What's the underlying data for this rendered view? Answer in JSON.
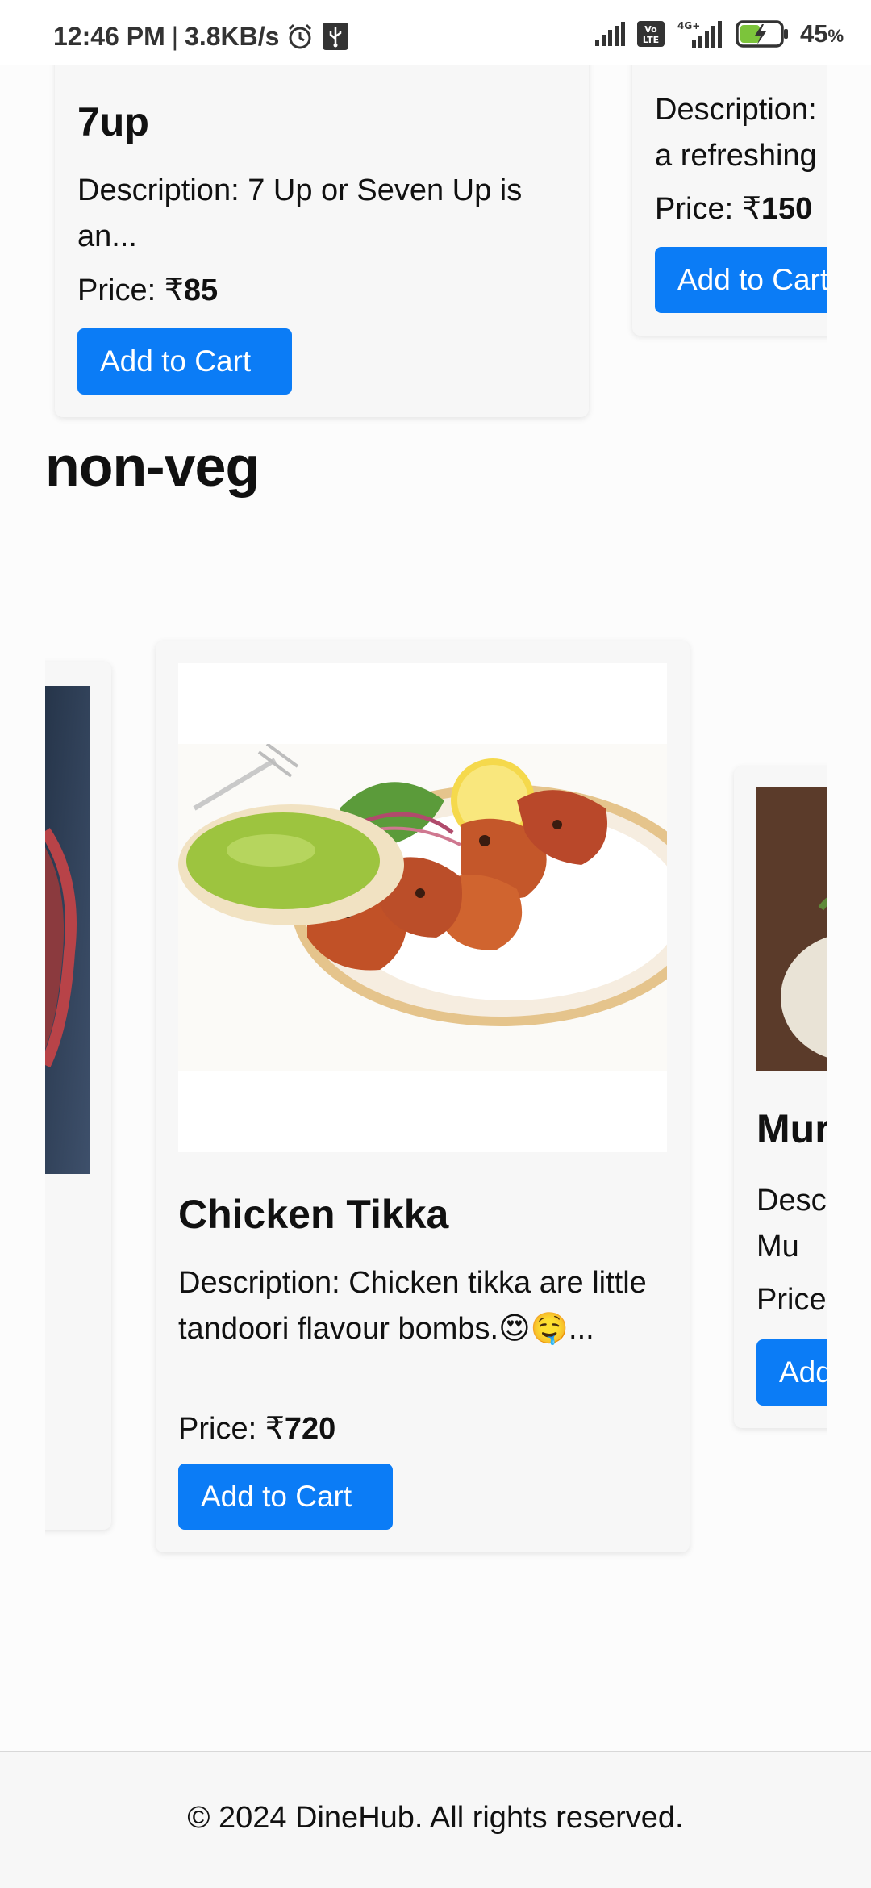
{
  "status_bar": {
    "time": "12:46 PM",
    "separator": "|",
    "net_speed": "3.8KB/s",
    "network_label": "4G+",
    "volte_label": "Vo LTE",
    "battery": "45",
    "battery_unit": "%"
  },
  "drinks": {
    "cards": [
      {
        "title": "7up",
        "description": "Description: 7 Up or Seven Up is an...",
        "price_label": "Price: ₹",
        "price_value": "85",
        "button": "Add to Cart"
      },
      {
        "title": "",
        "description": "Description: a refreshing",
        "price_label": "Price: ₹",
        "price_value": "150",
        "button": "Add to Cart"
      }
    ]
  },
  "section": {
    "title": "non-veg"
  },
  "nonveg": {
    "cards": [
      {
        "title": "Chicken Tikka",
        "description": "Description: Chicken tikka are little tandoori flavour bombs.😍🤤...",
        "price_label": "Price: ₹",
        "price_value": "720",
        "button": "Add to Cart"
      },
      {
        "title": "Mur",
        "description": "Desc a Mu",
        "price_label": "Price",
        "button": "Add"
      }
    ]
  },
  "footer": {
    "text": "© 2024 DineHub. All rights reserved."
  },
  "colors": {
    "primary_button": "#0b7cf6",
    "card_bg": "#f7f7f7",
    "page_bg": "#fcfcfc"
  }
}
